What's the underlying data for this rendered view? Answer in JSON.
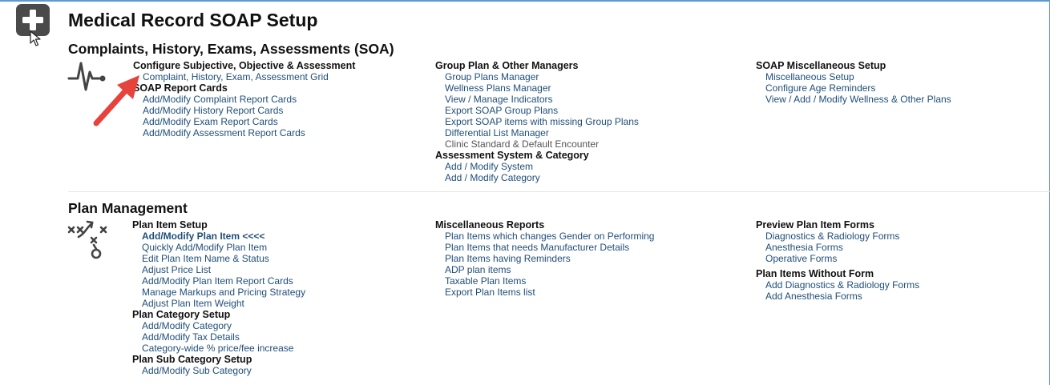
{
  "page": {
    "title": "Medical Record SOAP Setup"
  },
  "sections": {
    "soa": {
      "title": "Complaints, History, Exams, Assessments (SOA)",
      "icon": "heartbeat-icon",
      "col1": [
        {
          "header": "Configure Subjective, Objective & Assessment",
          "links": [
            {
              "label": "Complaint, History, Exam, Assessment Grid"
            }
          ]
        },
        {
          "header": "SOAP Report Cards",
          "links": [
            {
              "label": "Add/Modify Complaint Report Cards"
            },
            {
              "label": "Add/Modify History Report Cards"
            },
            {
              "label": "Add/Modify Exam Report Cards"
            },
            {
              "label": "Add/Modify Assessment Report Cards"
            }
          ]
        }
      ],
      "col2": [
        {
          "header": "Group Plan & Other Managers",
          "links": [
            {
              "label": "Group Plans Manager"
            },
            {
              "label": "Wellness Plans Manager"
            },
            {
              "label": "View / Manage Indicators"
            },
            {
              "label": "Export SOAP Group Plans"
            },
            {
              "label": "Export SOAP items with missing Group Plans"
            },
            {
              "label": "Differential List Manager"
            },
            {
              "label": "Clinic Standard & Default Encounter"
            }
          ]
        },
        {
          "header": "Assessment System & Category",
          "links": [
            {
              "label": "Add / Modify System"
            },
            {
              "label": "Add / Modify Category"
            }
          ]
        }
      ],
      "col3": [
        {
          "header": "SOAP Miscellaneous Setup",
          "links": [
            {
              "label": "Miscellaneous Setup"
            },
            {
              "label": "Configure Age Reminders"
            },
            {
              "label": "View / Add / Modify Wellness & Other Plans"
            }
          ]
        }
      ]
    },
    "plan": {
      "title": "Plan Management",
      "icon": "play-diagram-icon",
      "col1": [
        {
          "header": "Plan Item Setup",
          "links": [
            {
              "label": "Add/Modify Plan Item <<<<"
            },
            {
              "label": "Quickly Add/Modify Plan Item"
            },
            {
              "label": "Edit Plan Item Name & Status"
            },
            {
              "label": "Adjust Price List"
            },
            {
              "label": "Add/Modify Plan Item Report Cards"
            },
            {
              "label": "Manage Markups and Pricing Strategy"
            },
            {
              "label": "Adjust Plan Item Weight"
            }
          ]
        },
        {
          "header": "Plan Category Setup",
          "links": [
            {
              "label": "Add/Modify Category"
            },
            {
              "label": "Add/Modify Tax Details"
            },
            {
              "label": "Category-wide % price/fee increase"
            }
          ]
        },
        {
          "header": "Plan Sub Category Setup",
          "links": [
            {
              "label": "Add/Modify Sub Category"
            }
          ]
        }
      ],
      "col2": [
        {
          "header": "Miscellaneous Reports",
          "links": [
            {
              "label": "Plan Items which changes Gender on Performing"
            },
            {
              "label": "Plan Items that needs Manufacturer Details"
            },
            {
              "label": "Plan Items having Reminders"
            },
            {
              "label": "ADP plan items"
            },
            {
              "label": "Taxable Plan Items"
            },
            {
              "label": "Export Plan Items list"
            }
          ]
        }
      ],
      "col3": [
        {
          "header": "Preview Plan Item Forms",
          "links": [
            {
              "label": "Diagnostics & Radiology Forms"
            },
            {
              "label": "Anesthesia Forms"
            },
            {
              "label": "Operative Forms"
            }
          ]
        },
        {
          "header": "Plan Items Without Form",
          "links": [
            {
              "label": "Add Diagnostics & Radiology Forms"
            },
            {
              "label": "Add Anesthesia Forms"
            }
          ]
        }
      ]
    }
  },
  "icons": {
    "add": "plus-icon",
    "cursor": "mouse-cursor-icon",
    "annotation": "red-arrow-icon"
  },
  "colors": {
    "link": "#1f4e79",
    "accent_border": "#5b9bd5",
    "arrow": "#e8423c",
    "add_button": "#4a4a4a"
  }
}
